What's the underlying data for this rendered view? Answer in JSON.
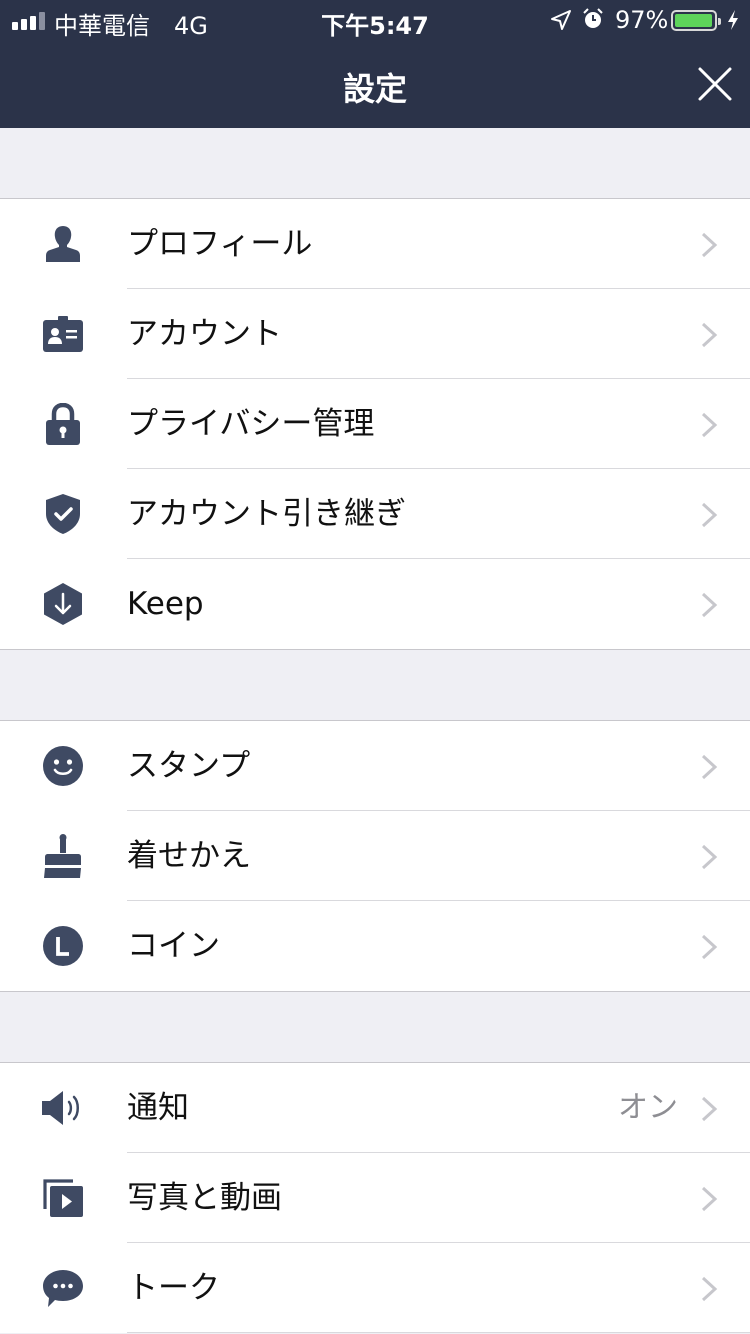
{
  "status_bar": {
    "carrier": "中華電信　4G",
    "time": "下午5:47",
    "battery_percent": "97%",
    "battery_level": 0.97,
    "icons": [
      "signal-icon",
      "location-arrow-icon",
      "alarm-icon",
      "battery-icon",
      "charging-bolt-icon"
    ]
  },
  "header": {
    "title": "設定",
    "close_icon": "close-icon"
  },
  "colors": {
    "header_bg": "#2b3349",
    "icon": "#3f4a63",
    "background": "#efeff4",
    "battery": "#5ed45a"
  },
  "groups": [
    {
      "items": [
        {
          "label": "プロフィール",
          "icon": "person-icon"
        },
        {
          "label": "アカウント",
          "icon": "id-card-icon"
        },
        {
          "label": "プライバシー管理",
          "icon": "lock-icon"
        },
        {
          "label": "アカウント引き継ぎ",
          "icon": "shield-check-icon"
        },
        {
          "label": "Keep",
          "icon": "keep-download-icon"
        }
      ]
    },
    {
      "items": [
        {
          "label": "スタンプ",
          "icon": "smiley-icon"
        },
        {
          "label": "着せかえ",
          "icon": "brush-icon"
        },
        {
          "label": "コイン",
          "icon": "coin-icon"
        }
      ]
    },
    {
      "items": [
        {
          "label": "通知",
          "icon": "speaker-icon",
          "value": "オン"
        },
        {
          "label": "写真と動画",
          "icon": "photo-video-icon"
        },
        {
          "label": "トーク",
          "icon": "chat-bubble-icon"
        }
      ]
    }
  ]
}
